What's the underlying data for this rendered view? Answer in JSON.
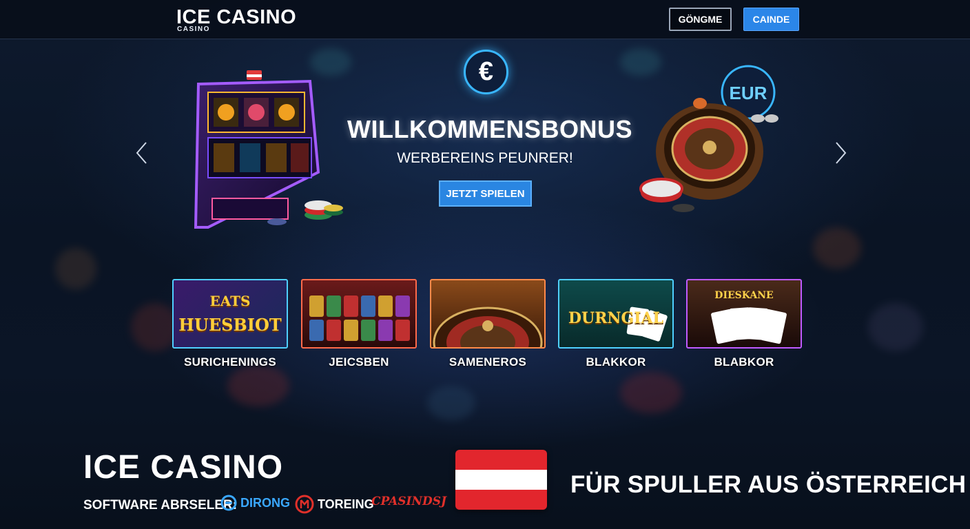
{
  "header": {
    "logo_main": "ICE CASINO",
    "logo_sub": "CASINO",
    "login_label": "GÖNGME",
    "register_label": "CAINDE"
  },
  "hero": {
    "badge_symbol": "€",
    "currency_badge": "EUR",
    "title": "WILLKOMMENSBONUS",
    "subtitle": "WERBEREINS PEUNRER!",
    "cta_label": "JETZT SPIELEN",
    "prev_icon": "chevron-left-icon",
    "next_icon": "chevron-right-icon"
  },
  "games": [
    {
      "label": "SURICHENINGS",
      "thumb_text": [
        "EATS",
        "HUESBIOT"
      ]
    },
    {
      "label": "JEICSBEN",
      "thumb_text": []
    },
    {
      "label": "SAMENEROS",
      "thumb_text": []
    },
    {
      "label": "BLAKKOR",
      "thumb_text": [
        "DURNGIAL"
      ]
    },
    {
      "label": "BLABKOR",
      "thumb_text": [
        "DIESKANE"
      ]
    }
  ],
  "bottom": {
    "brand": "ICE CASINO",
    "software_label": "SOFTWARE ABRSELER:",
    "providers": [
      "DIRONG",
      "TOREING",
      "CPASINDSJ"
    ],
    "players_text": "FÜR SPULLER AUS ÖSTERREICH"
  },
  "colors": {
    "accent_blue": "#2b86e8",
    "neon_cyan": "#39b6ff",
    "flag_red": "#e2262d"
  }
}
